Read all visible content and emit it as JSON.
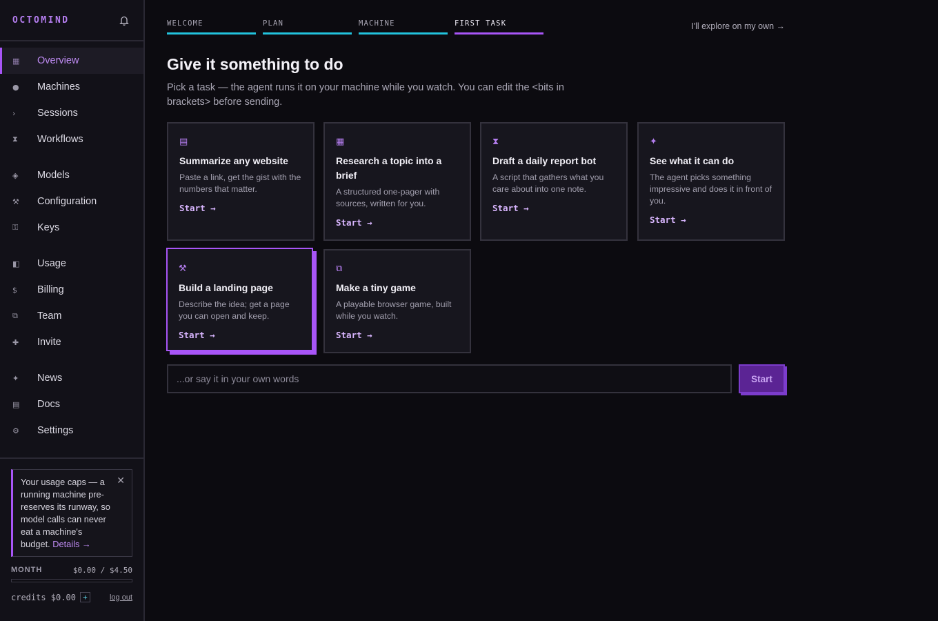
{
  "brand": "OCTOMIND",
  "icons": {
    "bell": "bell-icon",
    "close": "close-icon"
  },
  "colors": {
    "accent": "#a855f7",
    "progress": "#22c3dd",
    "background": "#0c0b10"
  },
  "nav": [
    {
      "label": "Overview",
      "icon": "▦",
      "active": true
    },
    {
      "label": "Machines",
      "icon": "●"
    },
    {
      "label": "Sessions",
      "icon": "›"
    },
    {
      "label": "Workflows",
      "icon": "⧗"
    },
    {
      "label": "Models",
      "icon": "◈"
    },
    {
      "label": "Configuration",
      "icon": "⚒"
    },
    {
      "label": "Keys",
      "icon": "⚿"
    },
    {
      "label": "Usage",
      "icon": "◧"
    },
    {
      "label": "Billing",
      "icon": "$"
    },
    {
      "label": "Team",
      "icon": "⧉"
    },
    {
      "label": "Invite",
      "icon": "✚"
    },
    {
      "label": "News",
      "icon": "✦"
    },
    {
      "label": "Docs",
      "icon": "▤"
    },
    {
      "label": "Settings",
      "icon": "⚙"
    }
  ],
  "notice": {
    "text": "Your usage caps — a running machine pre-reserves its runway, so model calls can never eat a machine's budget.",
    "link": "Details →",
    "close": "✕"
  },
  "usage": {
    "label": "MONTH",
    "value": "$0.00 / $4.50",
    "fraction": 0,
    "credits": "credits $0.00",
    "plus": "+",
    "logout": "log out"
  },
  "steps": [
    {
      "label": "WELCOME"
    },
    {
      "label": "PLAN"
    },
    {
      "label": "MACHINE"
    },
    {
      "label": "FIRST TASK",
      "current": true
    }
  ],
  "explore": "I'll explore on my own →",
  "heading": "Give it something to do",
  "lead": "Pick a task — the agent runs it on your machine while you watch. You can edit the <bits in brackets> before sending.",
  "cards": [
    {
      "icon": "▤",
      "icon_name": "document-icon",
      "title": "Summarize any website",
      "desc": "Paste a link, get the gist with the numbers that matter.",
      "cta": "Start →"
    },
    {
      "icon": "▦",
      "icon_name": "grid-icon",
      "title": "Research a topic into a brief",
      "desc": "A structured one-pager with sources, written for you.",
      "cta": "Start →"
    },
    {
      "icon": "⧗",
      "icon_name": "hourglass-icon",
      "title": "Draft a daily report bot",
      "desc": "A script that gathers what you care about into one note.",
      "cta": "Start →"
    },
    {
      "icon": "✦",
      "icon_name": "sparkle-icon",
      "title": "See what it can do",
      "desc": "The agent picks something impressive and does it in front of you.",
      "cta": "Start →"
    },
    {
      "icon": "⚒",
      "icon_name": "tools-icon",
      "title": "Build a landing page",
      "desc": "Describe the idea; get a page you can open and keep.",
      "cta": "Start →",
      "selected": true
    },
    {
      "icon": "⧉",
      "icon_name": "game-icon",
      "title": "Make a tiny game",
      "desc": "A playable browser game, built while you watch.",
      "cta": "Start →"
    }
  ],
  "input": {
    "placeholder": "...or say it in your own words",
    "value": ""
  },
  "start_button": "Start"
}
